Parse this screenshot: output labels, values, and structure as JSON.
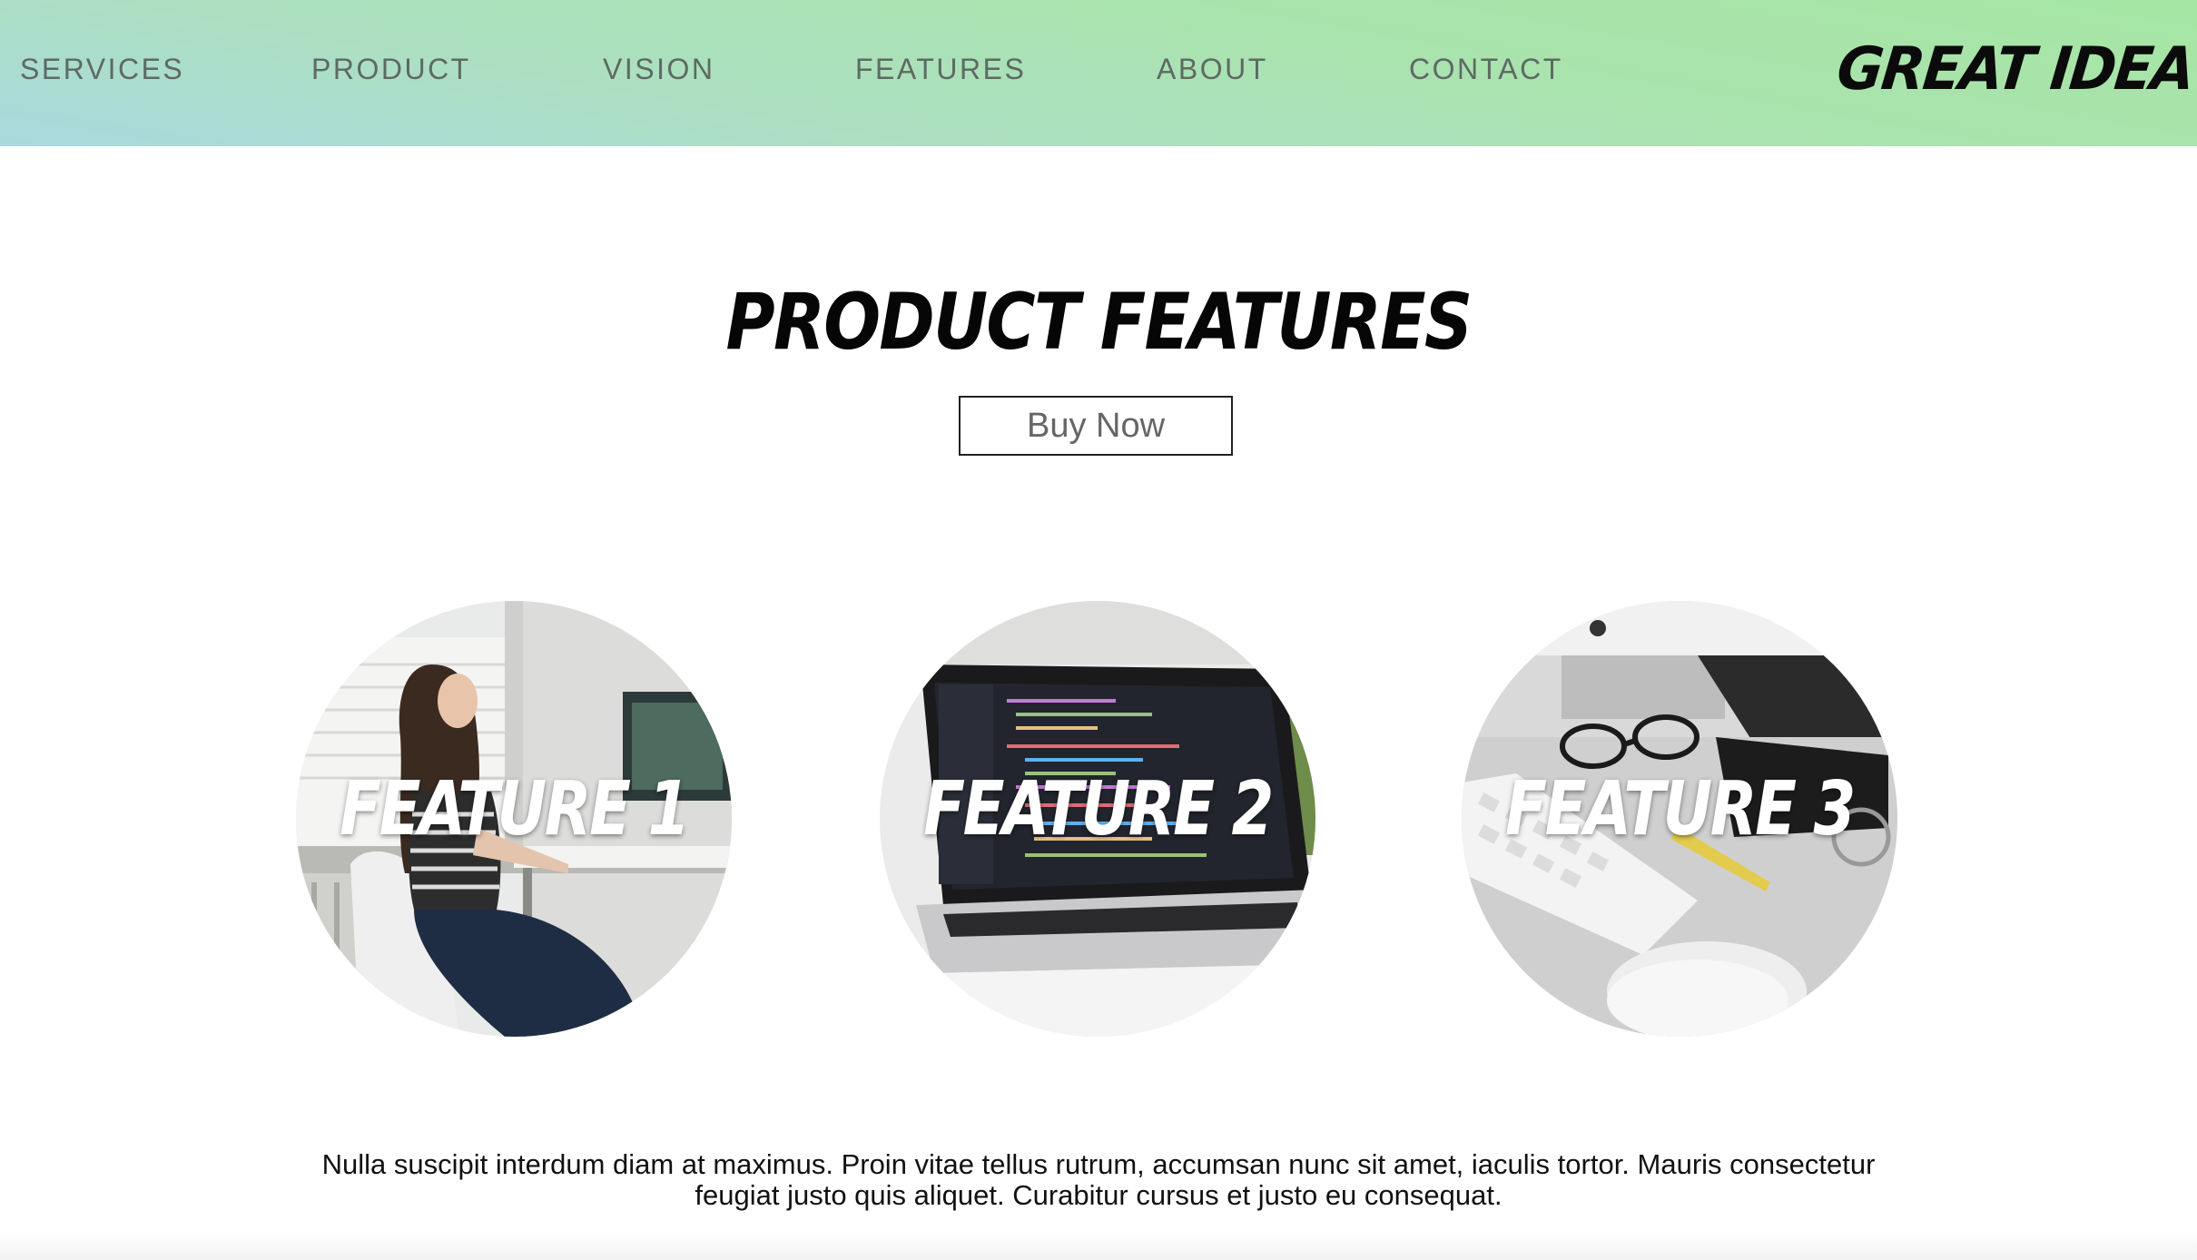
{
  "nav": {
    "items": [
      {
        "label": "SERVICES"
      },
      {
        "label": "PRODUCT"
      },
      {
        "label": "VISION"
      },
      {
        "label": "FEATURES"
      },
      {
        "label": "ABOUT"
      },
      {
        "label": "CONTACT"
      }
    ]
  },
  "logo": {
    "text": "GREAT IDEA",
    "icon": "lightbulb-icon"
  },
  "hero": {
    "title": "PRODUCT FEATURES",
    "buy_label": "Buy Now"
  },
  "features": [
    {
      "label": "FEATURE 1",
      "image": "woman-at-desk-photo"
    },
    {
      "label": "FEATURE 2",
      "image": "laptop-code-photo"
    },
    {
      "label": "FEATURE 3",
      "image": "desk-keyboard-photo"
    }
  ],
  "description": "Nulla suscipit interdum diam at maximus. Proin vitae tellus rutrum, accumsan nunc sit amet, iaculis tortor. Mauris consectetur feugiat justo quis aliquet. Curabitur cursus et justo eu consequat.",
  "colors": {
    "header_gradient_start": "#a9d9de",
    "header_gradient_end": "#a6e6a4",
    "nav_text": "#5d6a63",
    "title": "#060606"
  }
}
